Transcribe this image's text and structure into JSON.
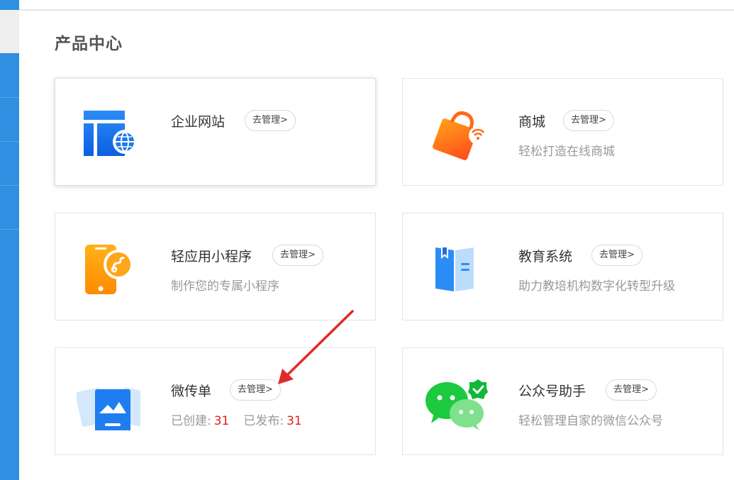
{
  "page": {
    "title": "产品中心"
  },
  "cards": [
    {
      "name": "企业网站",
      "manage_label": "去管理>",
      "desc": ""
    },
    {
      "name": "商城",
      "manage_label": "去管理>",
      "desc": "轻松打造在线商城"
    },
    {
      "name": "轻应用小程序",
      "manage_label": "去管理>",
      "desc": "制作您的专属小程序"
    },
    {
      "name": "教育系统",
      "manage_label": "去管理>",
      "desc": "助力教培机构数字化转型升级"
    },
    {
      "name": "微传单",
      "manage_label": "去管理>",
      "stats": {
        "created_label": "已创建:",
        "created_value": "31",
        "published_label": "已发布:",
        "published_value": "31"
      }
    },
    {
      "name": "公众号助手",
      "manage_label": "去管理>",
      "desc": "轻松管理自家的微信公众号"
    }
  ],
  "icons": [
    "website-icon",
    "shopping-bag-icon",
    "mini-program-phone-icon",
    "education-book-icon",
    "flyer-icon",
    "wechat-icon"
  ],
  "colors": {
    "sidebar": "#2f8fe0",
    "accent_red": "#e02020",
    "annotation_arrow": "#e02a2a"
  }
}
